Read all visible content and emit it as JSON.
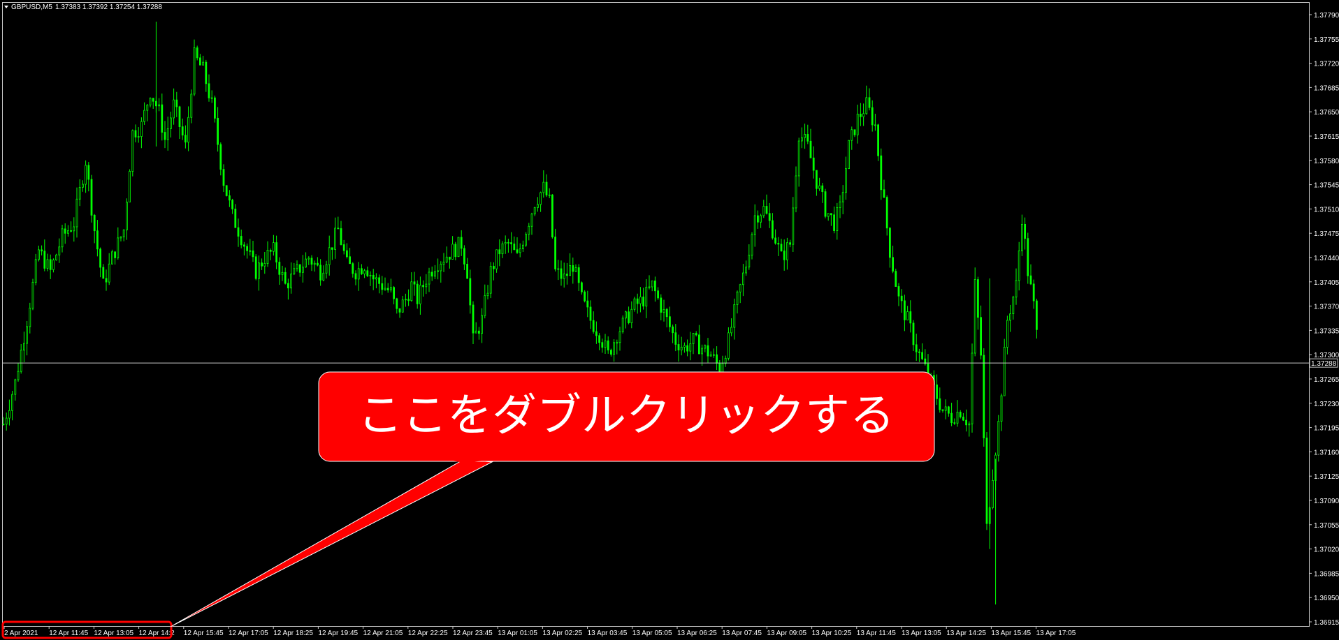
{
  "chart_info": {
    "symbol_timeframe": "GBPUSD,M5",
    "ohlc": "1.37383 1.37392 1.37254 1.37288",
    "dropdown_icon": "triangle-down-icon"
  },
  "colors": {
    "background": "#000000",
    "candle": "#00ff00",
    "axis": "#c8c8c8",
    "current_price_line": "#c8c8c8",
    "callout": "#ff0000",
    "highlight_box": "#ff0000",
    "text": "#ffffff"
  },
  "callout": {
    "text": "ここをダブルクリックする"
  },
  "current_price": {
    "label": "1.37288",
    "value": 1.37288
  },
  "chart_data": {
    "type": "candlestick",
    "ylim": [
      1.36897,
      1.37818
    ],
    "y_ticks": [
      "1.37790",
      "1.37755",
      "1.37720",
      "1.37685",
      "1.37650",
      "1.37615",
      "1.37580",
      "1.37545",
      "1.37510",
      "1.37475",
      "1.37440",
      "1.37405",
      "1.37370",
      "1.37335",
      "1.37300",
      "1.37265",
      "1.37230",
      "1.37195",
      "1.37160",
      "1.37125",
      "1.37090",
      "1.37055",
      "1.37020",
      "1.36985",
      "1.36950",
      "1.36915"
    ],
    "x_ticks": [
      "2 Apr 2021",
      "12 Apr 11:45",
      "12 Apr 13:05",
      "12 Apr 14:2",
      "12 Apr 15:45",
      "12 Apr 17:05",
      "12 Apr 18:25",
      "12 Apr 19:45",
      "12 Apr 21:05",
      "12 Apr 22:25",
      "12 Apr 23:45",
      "13 Apr 01:05",
      "13 Apr 02:25",
      "13 Apr 03:45",
      "13 Apr 05:05",
      "13 Apr 06:25",
      "13 Apr 07:45",
      "13 Apr 09:05",
      "13 Apr 10:25",
      "13 Apr 11:45",
      "13 Apr 13:05",
      "13 Apr 14:25",
      "13 Apr 15:45",
      "13 Apr 17:05"
    ],
    "highlighted_ticks": [
      "2 Apr 2021",
      "12 Apr 11:45",
      "12 Apr 13:05",
      "12 Apr 14:2"
    ],
    "price_path": [
      [
        0,
        1.372
      ],
      [
        4,
        1.3726
      ],
      [
        8,
        1.3735
      ],
      [
        12,
        1.3745
      ],
      [
        16,
        1.3742
      ],
      [
        20,
        1.3747
      ],
      [
        24,
        1.3749
      ],
      [
        28,
        1.3758
      ],
      [
        31,
        1.3748
      ],
      [
        34,
        1.374
      ],
      [
        37,
        1.3744
      ],
      [
        41,
        1.3748
      ],
      [
        44,
        1.3762
      ],
      [
        47,
        1.3763
      ],
      [
        50,
        1.3768
      ],
      [
        53,
        1.3765
      ],
      [
        55,
        1.3761
      ],
      [
        58,
        1.3766
      ],
      [
        62,
        1.376
      ],
      [
        65,
        1.3773
      ],
      [
        68,
        1.3771
      ],
      [
        71,
        1.3766
      ],
      [
        75,
        1.3755
      ],
      [
        78,
        1.375
      ],
      [
        82,
        1.3746
      ],
      [
        86,
        1.3742
      ],
      [
        89,
        1.3744
      ],
      [
        92,
        1.3745
      ],
      [
        96,
        1.374
      ],
      [
        100,
        1.3742
      ],
      [
        104,
        1.3744
      ],
      [
        108,
        1.3742
      ],
      [
        111,
        1.3745
      ],
      [
        114,
        1.3748
      ],
      [
        117,
        1.3743
      ],
      [
        120,
        1.3742
      ],
      [
        123,
        1.3743
      ],
      [
        126,
        1.3741
      ],
      [
        129,
        1.374
      ],
      [
        132,
        1.3739
      ],
      [
        134,
        1.3736
      ],
      [
        137,
        1.3738
      ],
      [
        139,
        1.374
      ],
      [
        141,
        1.3738
      ],
      [
        144,
        1.3741
      ],
      [
        147,
        1.3743
      ],
      [
        150,
        1.3744
      ],
      [
        153,
        1.3745
      ],
      [
        156,
        1.3746
      ],
      [
        158,
        1.3742
      ],
      [
        160,
        1.3732
      ],
      [
        163,
        1.3735
      ],
      [
        166,
        1.3742
      ],
      [
        169,
        1.3745
      ],
      [
        172,
        1.3746
      ],
      [
        175,
        1.3744
      ],
      [
        178,
        1.3748
      ],
      [
        181,
        1.3752
      ],
      [
        184,
        1.3754
      ],
      [
        186,
        1.3752
      ],
      [
        188,
        1.3742
      ],
      [
        191,
        1.3741
      ],
      [
        194,
        1.3743
      ],
      [
        197,
        1.3738
      ],
      [
        200,
        1.3735
      ],
      [
        203,
        1.3733
      ],
      [
        206,
        1.373
      ],
      [
        209,
        1.3733
      ],
      [
        212,
        1.3735
      ],
      [
        215,
        1.3737
      ],
      [
        218,
        1.3738
      ],
      [
        221,
        1.374
      ],
      [
        224,
        1.3737
      ],
      [
        226,
        1.3735
      ],
      [
        229,
        1.3732
      ],
      [
        232,
        1.3731
      ],
      [
        235,
        1.3732
      ],
      [
        238,
        1.3731
      ],
      [
        241,
        1.373
      ],
      [
        244,
        1.3728
      ],
      [
        247,
        1.3732
      ],
      [
        250,
        1.3738
      ],
      [
        253,
        1.3743
      ],
      [
        256,
        1.375
      ],
      [
        259,
        1.3751
      ],
      [
        262,
        1.3748
      ],
      [
        265,
        1.3744
      ],
      [
        268,
        1.3746
      ],
      [
        271,
        1.3762
      ],
      [
        274,
        1.376
      ],
      [
        277,
        1.3755
      ],
      [
        280,
        1.3751
      ],
      [
        283,
        1.3749
      ],
      [
        285,
        1.3751
      ],
      [
        288,
        1.376
      ],
      [
        291,
        1.3764
      ],
      [
        294,
        1.3766
      ],
      [
        297,
        1.3763
      ],
      [
        299,
        1.3755
      ],
      [
        302,
        1.3745
      ],
      [
        305,
        1.3738
      ],
      [
        308,
        1.3735
      ],
      [
        311,
        1.3731
      ],
      [
        314,
        1.3728
      ],
      [
        317,
        1.3725
      ],
      [
        320,
        1.3722
      ],
      [
        323,
        1.3721
      ],
      [
        326,
        1.3722
      ],
      [
        329,
        1.372
      ],
      [
        331,
        1.374
      ],
      [
        333,
        1.373
      ],
      [
        335,
        1.3705
      ],
      [
        337,
        1.3713
      ],
      [
        339,
        1.372
      ],
      [
        342,
        1.3735
      ],
      [
        345,
        1.374
      ],
      [
        347,
        1.375
      ],
      [
        349,
        1.3742
      ],
      [
        351,
        1.3737
      ],
      [
        352,
        1.3733
      ]
    ]
  }
}
